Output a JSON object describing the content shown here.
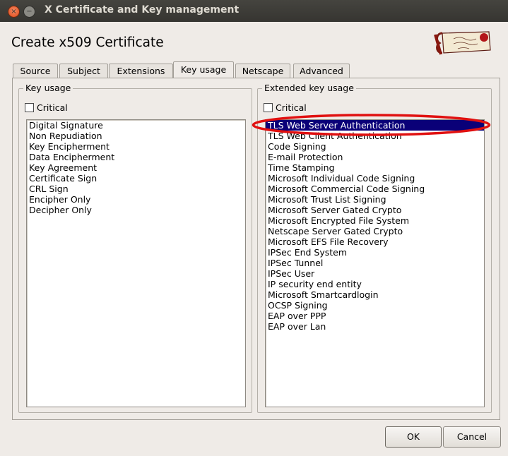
{
  "window": {
    "title": "X Certificate and Key management",
    "close_icon": "×",
    "min_icon": "−"
  },
  "dialog": {
    "title": "Create x509 Certificate",
    "logo": "xca-logo-icon"
  },
  "tabs": [
    {
      "label": "Source"
    },
    {
      "label": "Subject"
    },
    {
      "label": "Extensions"
    },
    {
      "label": "Key usage"
    },
    {
      "label": "Netscape"
    },
    {
      "label": "Advanced"
    }
  ],
  "key_usage": {
    "group_title": "Key usage",
    "critical_label": "Critical",
    "critical_checked": false,
    "items": [
      "Digital Signature",
      "Non Repudiation",
      "Key Encipherment",
      "Data Encipherment",
      "Key Agreement",
      "Certificate Sign",
      "CRL Sign",
      "Encipher Only",
      "Decipher Only"
    ]
  },
  "extended_key_usage": {
    "group_title": "Extended key usage",
    "critical_label": "Critical",
    "critical_checked": false,
    "selected_index": 0,
    "highlight_color": "#e01010",
    "items": [
      "TLS Web Server Authentication",
      "TLS Web Client Authentication",
      "Code Signing",
      "E-mail Protection",
      "Time Stamping",
      "Microsoft Individual Code Signing",
      "Microsoft Commercial Code Signing",
      "Microsoft Trust List Signing",
      "Microsoft Server Gated Crypto",
      "Microsoft Encrypted File System",
      "Netscape Server Gated Crypto",
      "Microsoft EFS File Recovery",
      "IPSec End System",
      "IPSec Tunnel",
      "IPSec User",
      "IP security end entity",
      "Microsoft Smartcardlogin",
      "OCSP Signing",
      "EAP over PPP",
      "EAP over Lan"
    ]
  },
  "buttons": {
    "ok": "OK",
    "cancel": "Cancel"
  },
  "colors": {
    "selection": "#0a0078",
    "titlebar": "#3c3b37",
    "window_bg": "#efebe7"
  }
}
